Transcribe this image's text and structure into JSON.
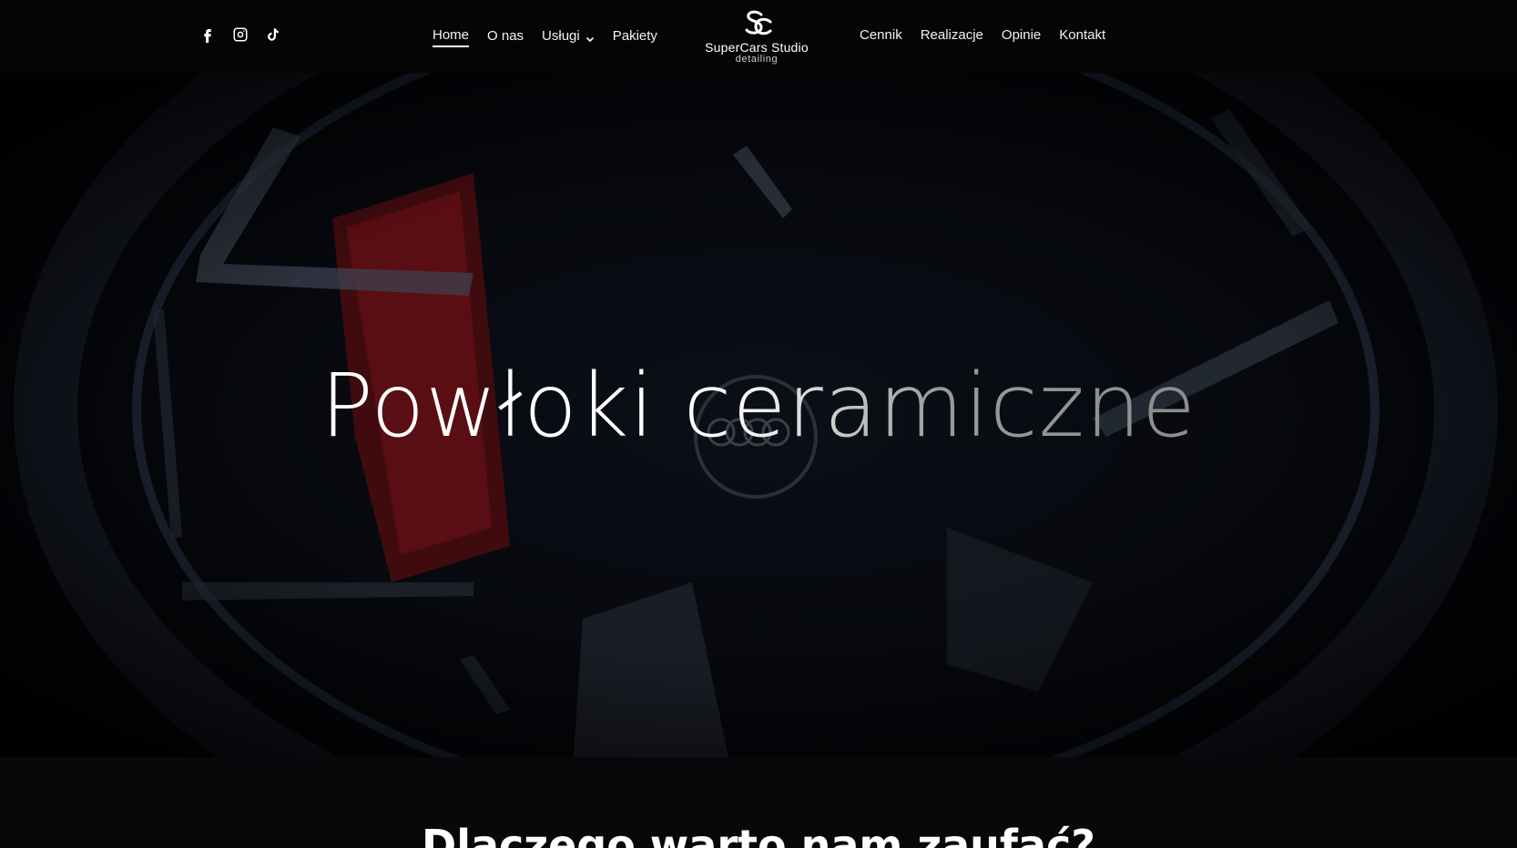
{
  "header": {
    "social": [
      {
        "icon": "facebook-icon"
      },
      {
        "icon": "instagram-icon"
      },
      {
        "icon": "tiktok-icon"
      }
    ],
    "nav_left": [
      {
        "label": "Home",
        "active": true
      },
      {
        "label": "O nas"
      },
      {
        "label": "Usługi",
        "dropdown": true
      },
      {
        "label": "Pakiety"
      }
    ],
    "logo": {
      "name": "SuperCars Studio",
      "sub": "detailing"
    },
    "nav_right": [
      {
        "label": "Cennik"
      },
      {
        "label": "Realizacje"
      },
      {
        "label": "Opinie"
      },
      {
        "label": "Kontakt"
      }
    ]
  },
  "hero": {
    "title": "Powłoki ceramiczne"
  },
  "section2": {
    "heading": "Dlaczego warto nam zaufać?"
  }
}
